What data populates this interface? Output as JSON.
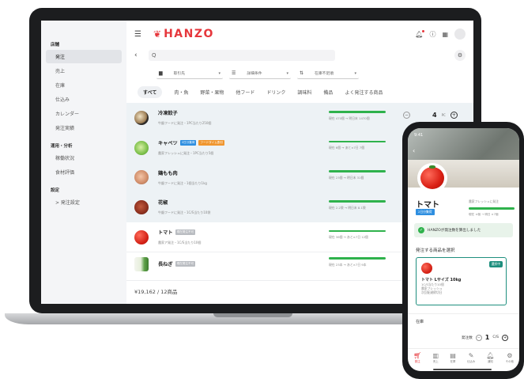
{
  "app": {
    "brand": "HANZO",
    "sidebar": {
      "sections": [
        {
          "heading": "店舗",
          "items": [
            {
              "label": "発注",
              "active": true
            },
            {
              "label": "売上"
            },
            {
              "label": "在庫"
            },
            {
              "label": "仕込み"
            },
            {
              "label": "カレンダー"
            },
            {
              "label": "発注実績"
            }
          ]
        },
        {
          "heading": "運用・分析",
          "items": [
            {
              "label": "稼働状況"
            },
            {
              "label": "食材評価"
            }
          ]
        },
        {
          "heading": "設定",
          "items": [
            {
              "label": "> 発注設定"
            }
          ]
        }
      ]
    },
    "search": {
      "placeholder": "Q"
    },
    "filters": [
      {
        "icon": "store-icon",
        "label": "取引先"
      },
      {
        "icon": "filter-list-icon",
        "label": "詳細条件"
      },
      {
        "icon": "sort-icon",
        "label": "在庫不足順"
      }
    ],
    "tabs": [
      {
        "label": "すべて",
        "active": true
      },
      {
        "label": "肉・魚"
      },
      {
        "label": "野菜・果物"
      },
      {
        "label": "他フード"
      },
      {
        "label": "ドリンク"
      },
      {
        "label": "調味料"
      },
      {
        "label": "備品"
      },
      {
        "label": "よく発注する商品"
      }
    ],
    "products": [
      {
        "name": "冷凍餃子",
        "badges": [],
        "desc": "牛鍛フードに発注・1PC当たり250個",
        "stock_level": 1.0,
        "stock": "現在 470個 → 明日末 1470個",
        "qty": "4",
        "unit": "PC",
        "thumb": "gyoza",
        "selected": true
      },
      {
        "name": "キャベツ",
        "badges": [
          {
            "text": "2日分集荷",
            "color": "#2f8fe0"
          },
          {
            "text": "フードタイム割引",
            "color": "#f0962f"
          }
        ],
        "desc": "農家フレッシュに発注・1PC当たり5個",
        "stock_level": 1.0,
        "stock": "現在 6個 → あと×7日 7個",
        "thumb": "cabbage",
        "selected": true
      },
      {
        "name": "鶏もも肉",
        "badges": [],
        "desc": "牛鍛フードに発注・1個当たり1kg",
        "stock_level": 1.0,
        "stock": "現在 23個 → 明日末 31個",
        "thumb": "chicken",
        "selected": true
      },
      {
        "name": "花椒",
        "badges": [],
        "desc": "牛鍛フードに発注・1C/S当たり10袋",
        "stock_level": 1.0,
        "stock": "現在 2.2袋 → 明日末 8.1袋",
        "thumb": "pepper",
        "selected": true
      },
      {
        "name": "トマト",
        "badges": [
          {
            "text": "現在発注不可",
            "color": "#b9bcc1"
          }
        ],
        "desc": "農家ア発注・1C/S当たり10個",
        "stock_level": 1.0,
        "stock": "現在 36個 → あと×7日 12個",
        "thumb": "tomato",
        "selected": false
      },
      {
        "name": "長ねぎ",
        "badges": [
          {
            "text": "現在発注不可",
            "color": "#b9bcc1"
          }
        ],
        "desc": "",
        "stock_level": 1.0,
        "stock": "現在 23本 → あと×7日 9本",
        "thumb": "leek",
        "selected": false
      }
    ],
    "footer_total": "¥19,162 / 12商品"
  },
  "phone": {
    "status_time": "9:41",
    "product_name": "トマト",
    "badge": "2日分集荷",
    "supplier_label": "農家フレッシュに発注",
    "stock_level": 1.0,
    "stock": "現在 ×個 → 明日 ×7個",
    "notice": "HANZOが発注数を算出しました",
    "select_heading": "発注する商品を選択",
    "card": {
      "selected_label": "選択中",
      "name": "トマト Lサイズ 10kg",
      "lines": [
        "1C/S当たり10個",
        "農家フレッシュ",
        "次回配達締切日"
      ]
    },
    "stock_heading": "在庫",
    "qty_label": "発注数",
    "qty": "1",
    "qty_unit": "C/S",
    "nav": [
      {
        "icon": "cart-icon",
        "label": "発注",
        "active": true
      },
      {
        "icon": "chart-icon",
        "label": "売上"
      },
      {
        "icon": "box-icon",
        "label": "在庫"
      },
      {
        "icon": "pencil-icon",
        "label": "仕込み"
      },
      {
        "icon": "bell-icon",
        "label": "通知"
      },
      {
        "icon": "gear-icon",
        "label": "その他"
      }
    ]
  },
  "colors": {
    "brand": "#e6373c",
    "stock_bar": "#2fb24c",
    "selected_row": "#edf2f5",
    "card_accent": "#1e8f7e"
  }
}
